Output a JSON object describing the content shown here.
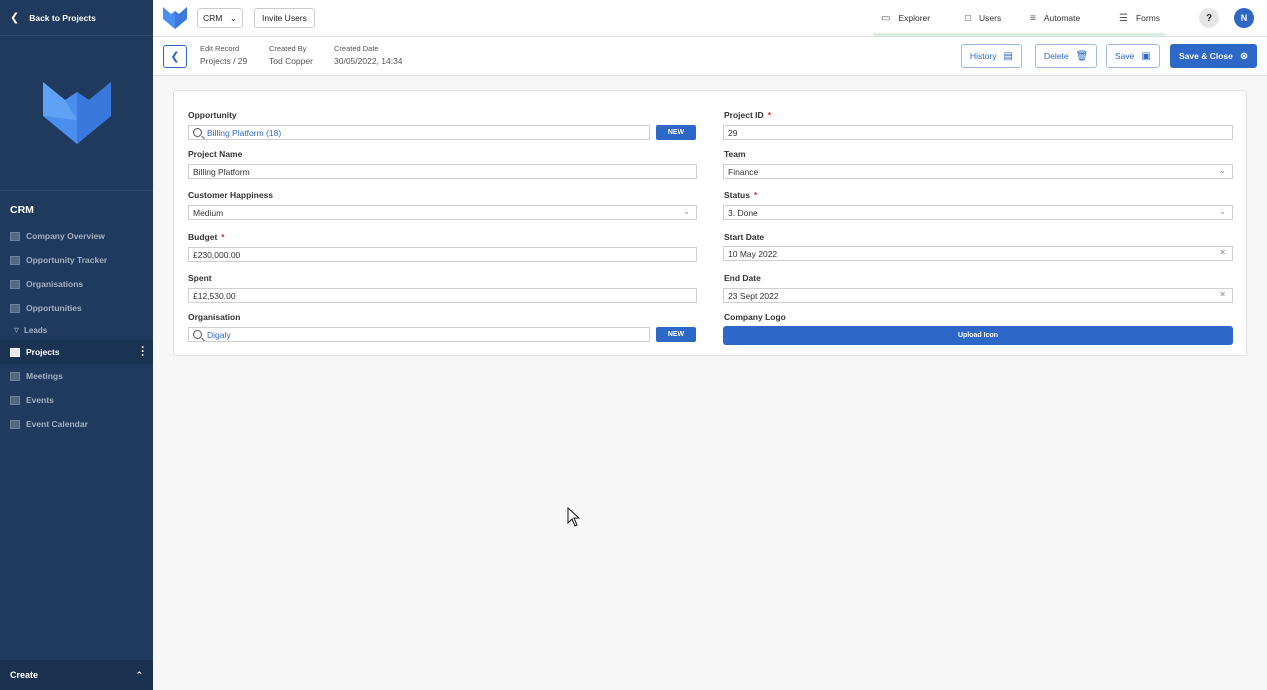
{
  "sidebar": {
    "back_label": "Back to Projects",
    "section_title": "CRM",
    "items": [
      {
        "label": "Company Overview"
      },
      {
        "label": "Opportunity Tracker"
      },
      {
        "label": "Organisations"
      },
      {
        "label": "Opportunities"
      },
      {
        "label": "Leads"
      },
      {
        "label": "Projects"
      },
      {
        "label": "Meetings"
      },
      {
        "label": "Events"
      },
      {
        "label": "Event Calendar"
      }
    ],
    "create_label": "Create"
  },
  "topbar": {
    "app_select": "CRM",
    "invite_label": "Invite Users",
    "nav": [
      {
        "label": "Explorer",
        "icon": "explorer-icon"
      },
      {
        "label": "Users",
        "icon": "lock-icon"
      },
      {
        "label": "Automate",
        "icon": "automate-icon"
      },
      {
        "label": "Forms",
        "icon": "forms-icon"
      }
    ],
    "help_label": "?",
    "avatar_initial": "N"
  },
  "record": {
    "edit_label": "Edit Record",
    "edit_value": "Projects / 29",
    "created_by_label": "Created By",
    "created_by_value": "Tod Copper",
    "created_date_label": "Created Date",
    "created_date_value": "30/05/2022, 14:34",
    "buttons": {
      "history": "History",
      "delete": "Delete",
      "save": "Save",
      "save_close": "Save & Close"
    }
  },
  "form": {
    "opportunity": {
      "label": "Opportunity",
      "value": "Billing Platform (18)",
      "new": "NEW"
    },
    "project_name": {
      "label": "Project Name",
      "value": "Billing Platform"
    },
    "customer_happiness": {
      "label": "Customer Happiness",
      "value": "Medium"
    },
    "budget": {
      "label": "Budget",
      "value": "£230,000.00",
      "required": "*"
    },
    "spent": {
      "label": "Spent",
      "value": "£12,530.00"
    },
    "organisation": {
      "label": "Organisation",
      "value": "Digaly",
      "new": "NEW"
    },
    "project_id": {
      "label": "Project ID",
      "value": "29",
      "required": "*"
    },
    "team": {
      "label": "Team",
      "value": "Finance"
    },
    "status": {
      "label": "Status",
      "value": "3. Done",
      "required": "*"
    },
    "start_date": {
      "label": "Start Date",
      "value": "10 May 2022"
    },
    "end_date": {
      "label": "End Date",
      "value": "23 Sept 2022"
    },
    "company_logo": {
      "label": "Company Logo",
      "button": "Upload Icon"
    }
  }
}
